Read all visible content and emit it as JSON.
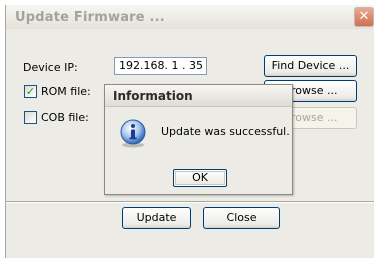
{
  "window": {
    "title": "Update Firmware ...",
    "close_glyph": "✕"
  },
  "form": {
    "device_ip_label": "Device IP:",
    "device_ip_value": "192.168.  1  . 35",
    "find_device_label": "Find Device ...",
    "rom_label": "ROM file:",
    "rom_checked": true,
    "rom_check_glyph": "✓",
    "rom_browse_label": "Browse ...",
    "cob_label": "COB file:",
    "cob_checked": false,
    "cob_browse_label": "Browse ..."
  },
  "footer": {
    "update_label": "Update",
    "close_label": "Close"
  },
  "dialog": {
    "title": "Information",
    "message": "Update was successful.",
    "ok_label": "OK",
    "icon": "info-icon"
  }
}
